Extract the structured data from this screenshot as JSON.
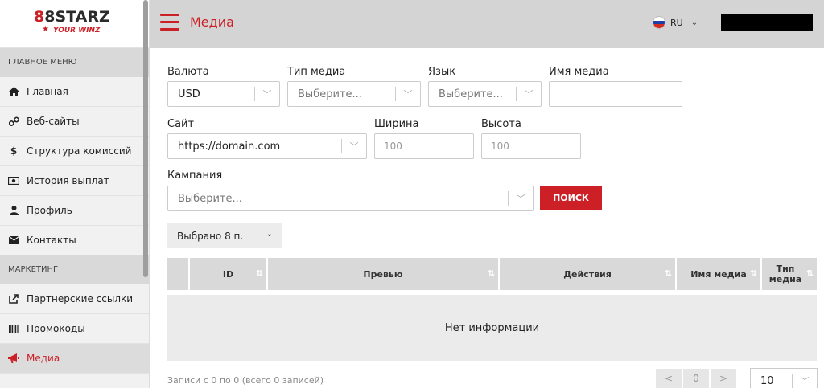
{
  "brand": {
    "logo_left": "8",
    "logo_mid": "8",
    "logo_right": "STARZ",
    "logo_sub": "YOUR WINZ"
  },
  "sidebar": {
    "sections": [
      {
        "title": "ГЛАВНОЕ МЕНЮ",
        "items": [
          {
            "label": "Главная",
            "icon": "home-icon"
          },
          {
            "label": "Веб-сайты",
            "icon": "link-icon"
          },
          {
            "label": "Структура комиссий",
            "icon": "dollar-icon"
          },
          {
            "label": "История выплат",
            "icon": "money-icon"
          },
          {
            "label": "Профиль",
            "icon": "user-icon"
          },
          {
            "label": "Контакты",
            "icon": "envelope-icon"
          }
        ]
      },
      {
        "title": "МАРКЕТИНГ",
        "items": [
          {
            "label": "Партнерские ссылки",
            "icon": "external-link-icon"
          },
          {
            "label": "Промокоды",
            "icon": "barcode-icon"
          },
          {
            "label": "Медиа",
            "icon": "bullhorn-icon",
            "active": true
          }
        ]
      }
    ]
  },
  "header": {
    "title": "Медиа",
    "lang": "RU"
  },
  "filters": {
    "currency": {
      "label": "Валюта",
      "value": "USD"
    },
    "media_type": {
      "label": "Тип медиа",
      "placeholder": "Выберите..."
    },
    "language": {
      "label": "Язык",
      "placeholder": "Выберите..."
    },
    "media_name": {
      "label": "Имя медиа",
      "value": ""
    },
    "site": {
      "label": "Сайт",
      "value": "https://domain.com"
    },
    "width": {
      "label": "Ширина",
      "placeholder": "100"
    },
    "height": {
      "label": "Высота",
      "placeholder": "100"
    },
    "campaign": {
      "label": "Кампания",
      "placeholder": "Выберите..."
    },
    "search_label": "ПОИСК"
  },
  "columns_selector": {
    "label": "Выбрано 8 п."
  },
  "table": {
    "columns": [
      "",
      "ID",
      "Превью",
      "Действия",
      "Имя медиа",
      "Тип медиа"
    ],
    "empty": "Нет информации"
  },
  "footer": {
    "records": "Записи с 0 по 0 (всего 0 записей)",
    "prev": "<",
    "page": "0",
    "next": ">",
    "per_page": "10"
  },
  "colors": {
    "accent": "#cc2027",
    "header_bg": "#d4d4d4",
    "sidebar_bg": "#f1f1f1"
  }
}
